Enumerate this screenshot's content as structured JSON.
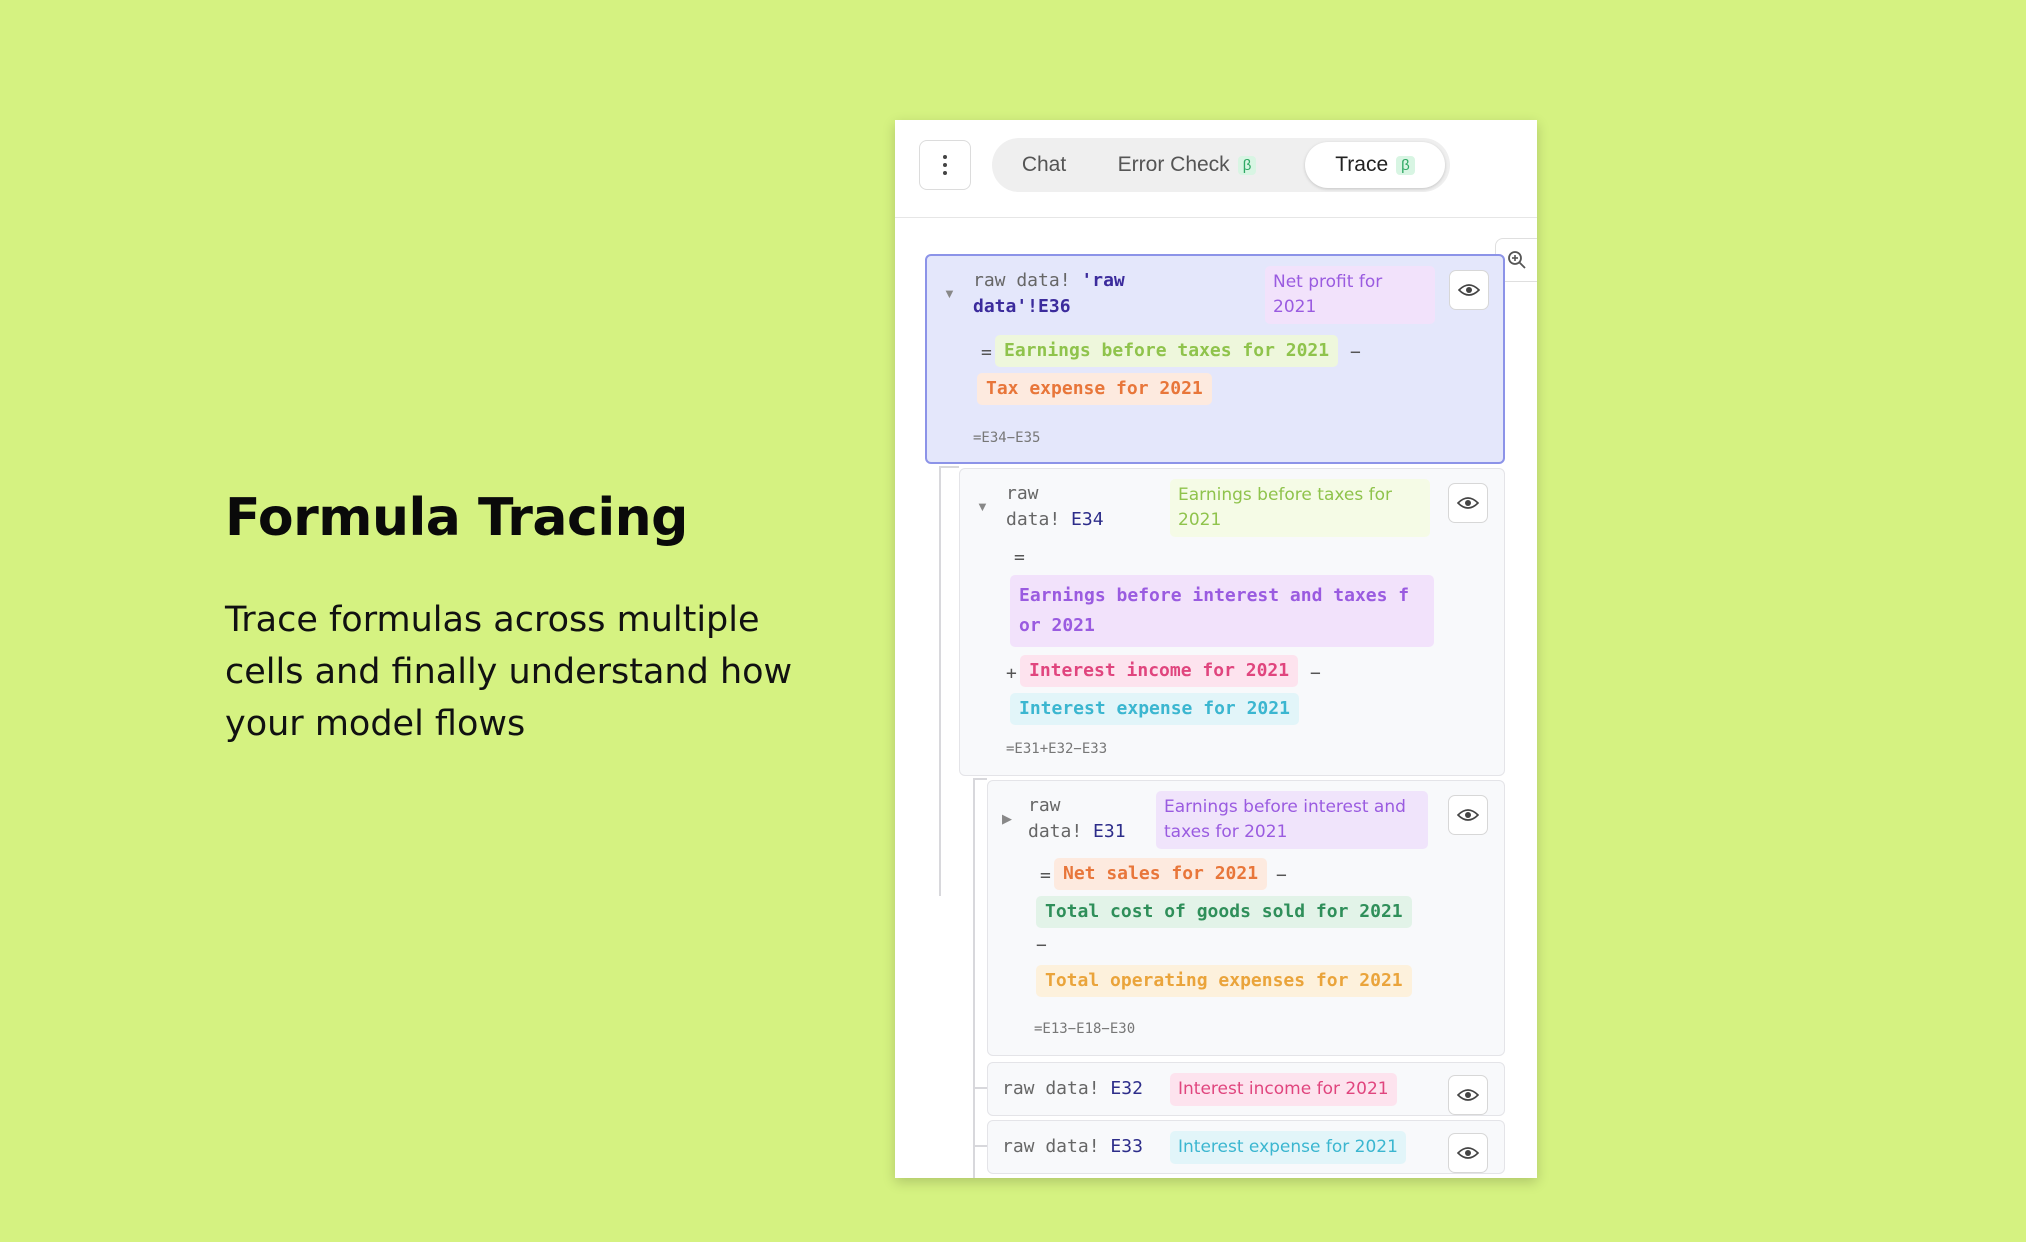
{
  "hero": {
    "title": "Formula Tracing",
    "subtitle": "Trace formulas across multiple cells and finally understand how your model flows"
  },
  "panel": {
    "menu_icon": "more-vertical-icon",
    "tabs": [
      {
        "label": "Chat",
        "beta": "",
        "active": false
      },
      {
        "label": "Error Check",
        "beta": "β",
        "active": false
      },
      {
        "label": "Trace",
        "beta": "β",
        "active": true
      }
    ],
    "zoom_icon": "zoom-in-icon"
  },
  "colors": {
    "background": "#d5f281",
    "root_node": "#e4e7fb",
    "green_token": "#8fc34c",
    "orange_token": "#e8763a",
    "purple_token": "#9a5be0",
    "pink_token": "#e0457e",
    "cyan_token": "#3bb6d0",
    "teal_token": "#2f8f5a",
    "amber_token": "#eaa43b"
  },
  "trace": {
    "root": {
      "sheet": "raw data!",
      "ref_line1": "'raw",
      "ref_line2": "data'!E36",
      "label": "Net profit for 2021",
      "tokens": [
        "Earnings before taxes for 2021",
        "Tax expense for 2021"
      ],
      "eq": "=",
      "op1": "−",
      "formula": "=E34−E35"
    },
    "e34": {
      "sheet_line1": "raw",
      "sheet_line2": "data!",
      "ref": "E34",
      "label": "Earnings before taxes for 2021",
      "eq": "=",
      "token1_line1": "Earnings before interest and taxes f",
      "token1_line2": "or 2021",
      "op_plus": "+",
      "token2": "Interest income for 2021",
      "op_minus": "−",
      "token3": "Interest expense for 2021",
      "formula": "=E31+E32−E33"
    },
    "e31": {
      "sheet_line1": "raw",
      "sheet_line2": "data!",
      "ref": "E31",
      "label": "Earnings before interest and taxes for 2021",
      "eq": "=",
      "token1": "Net sales for 2021",
      "op1": "−",
      "token2": "Total cost of goods sold for 2021",
      "op2": "−",
      "token3": "Total operating expenses for 2021",
      "formula": "=E13−E18−E30"
    },
    "e32": {
      "sheet": "raw data!",
      "ref": "E32",
      "label": "Interest income for 2021"
    },
    "e33": {
      "sheet": "raw data!",
      "ref": "E33",
      "label": "Interest expense for 2021"
    }
  }
}
